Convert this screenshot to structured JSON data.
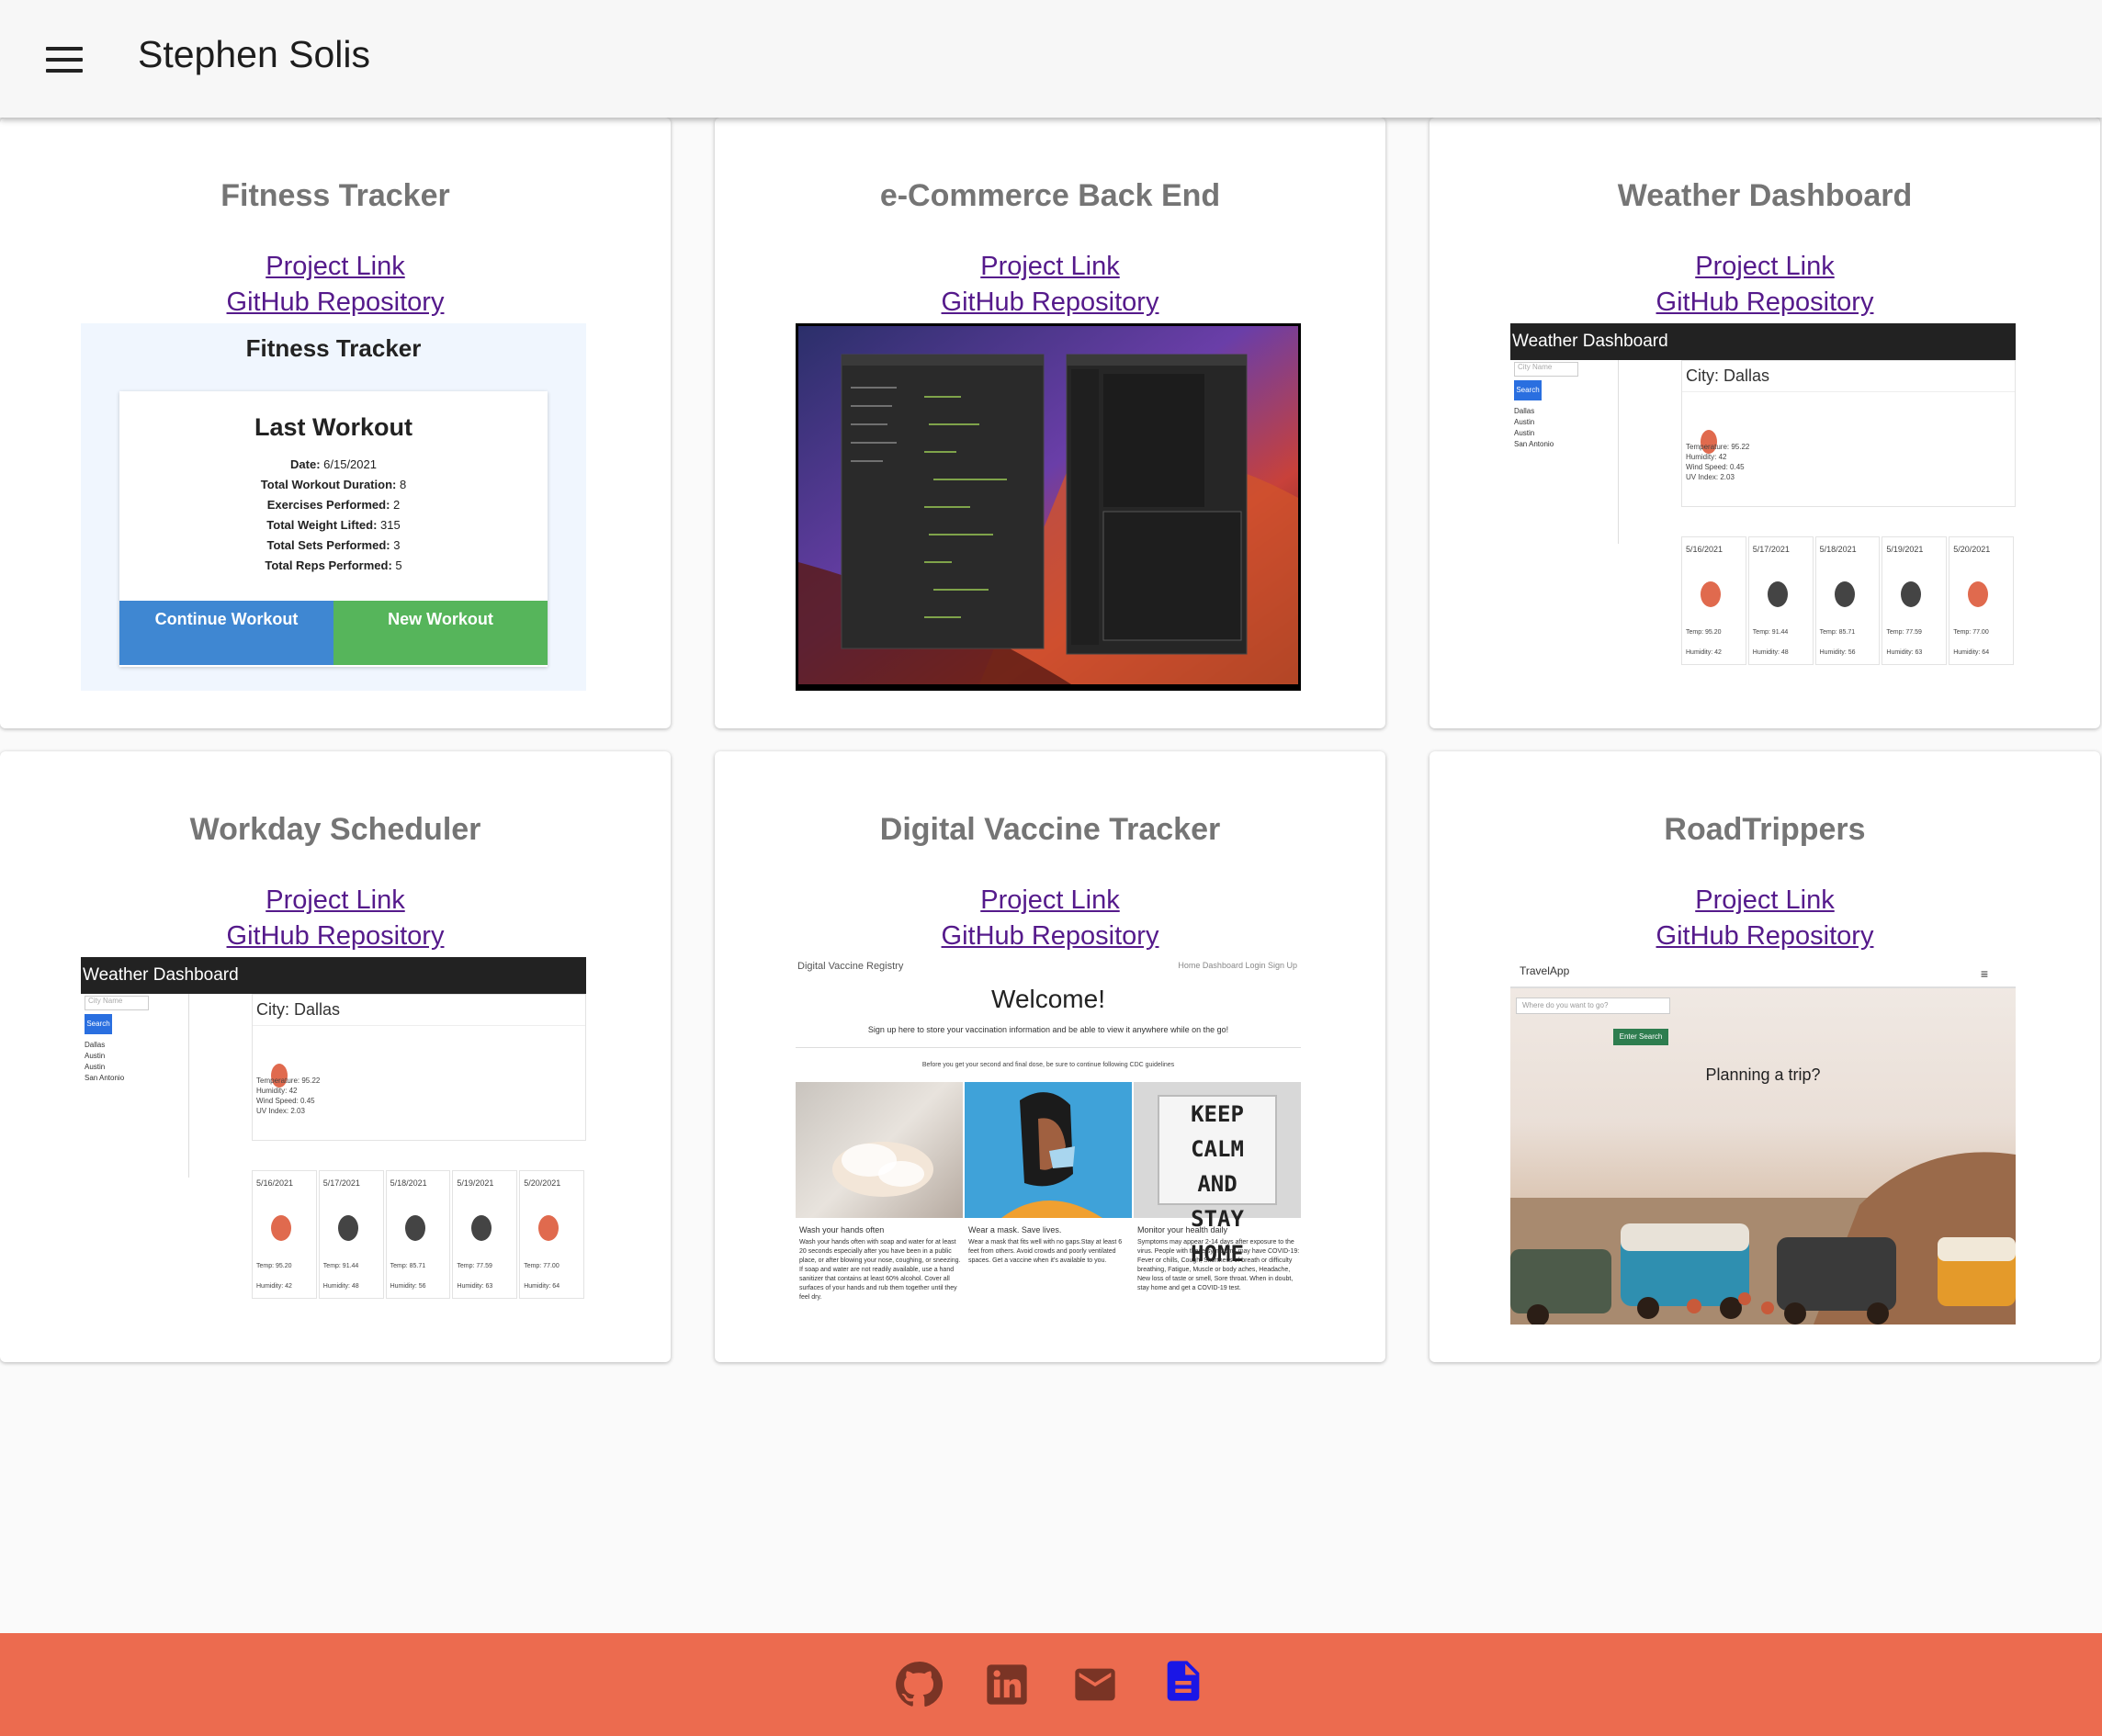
{
  "header": {
    "title": "Stephen Solis"
  },
  "links": {
    "project": "Project Link",
    "github": "GitHub Repository"
  },
  "projects": [
    {
      "title": "Fitness Tracker"
    },
    {
      "title": "e-Commerce Back End"
    },
    {
      "title": "Weather Dashboard"
    },
    {
      "title": "Workday Scheduler"
    },
    {
      "title": "Digital Vaccine Tracker"
    },
    {
      "title": "RoadTrippers"
    }
  ],
  "fitness_shot": {
    "heading": "Fitness Tracker",
    "card_title": "Last Workout",
    "stats": [
      {
        "label": "Date",
        "value": "6/15/2021"
      },
      {
        "label": "Total Workout Duration",
        "value": "8"
      },
      {
        "label": "Exercises Performed",
        "value": "2"
      },
      {
        "label": "Total Weight Lifted",
        "value": "315"
      },
      {
        "label": "Total Sets Performed",
        "value": "3"
      },
      {
        "label": "Total Reps Performed",
        "value": "5"
      }
    ],
    "continue": "Continue Workout",
    "new": "New Workout"
  },
  "weather_shot": {
    "bar": "Weather Dashboard",
    "placeholder": "City Name",
    "search": "Search",
    "cities": [
      "Dallas",
      "Austin",
      "Austin",
      "San Antonio"
    ],
    "city": "City: Dallas",
    "stats": [
      "Temperature: 95.22",
      "Humidity: 42",
      "Wind Speed: 0.45",
      "UV Index: 2.03"
    ],
    "days": [
      {
        "date": "5/16/2021",
        "temp": "Temp: 95.20",
        "hum": "Humidity: 42"
      },
      {
        "date": "5/17/2021",
        "temp": "Temp: 91.44",
        "hum": "Humidity: 48"
      },
      {
        "date": "5/18/2021",
        "temp": "Temp: 85.71",
        "hum": "Humidity: 56"
      },
      {
        "date": "5/19/2021",
        "temp": "Temp: 77.59",
        "hum": "Humidity: 63"
      },
      {
        "date": "5/20/2021",
        "temp": "Temp: 77.00",
        "hum": "Humidity: 64"
      }
    ]
  },
  "vaccine_shot": {
    "brand": "Digital Vaccine Registry",
    "nav": "Home  Dashboard  Login  Sign Up",
    "welcome": "Welcome!",
    "sub": "Sign up here to store your vaccination information and be able to view it anywhere while on the go!",
    "sub2": "Before you get your second and final dose, be sure to continue following CDC guidelines",
    "sign": [
      "KEEP CALM",
      "AND",
      "STAY HOME"
    ],
    "cols": [
      {
        "title": "Wash your hands often",
        "text": "Wash your hands often with soap and water for at least 20 seconds especially after you have been in a public place, or after blowing your nose, coughing, or sneezing. If soap and water are not readily available, use a hand sanitizer that contains at least 60% alcohol. Cover all surfaces of your hands and rub them together until they feel dry."
      },
      {
        "title": "Wear a mask. Save lives.",
        "text": "Wear a mask that fits well with no gaps.Stay at least 6 feet from others. Avoid crowds and poorly ventilated spaces. Get a vaccine when it's available to you."
      },
      {
        "title": "Monitor your health daily",
        "text": "Symptoms may appear 2-14 days after exposure to the virus. People with these symptoms may have COVID-19: Fever or chills, Cough, Shortness of breath or difficulty breathing, Fatigue, Muscle or body aches, Headache, New loss of taste or smell, Sore throat. When in doubt, stay home and get a COVID-19 test."
      }
    ]
  },
  "road_shot": {
    "app": "TravelApp",
    "placeholder": "Where do you want to go?",
    "button": "Enter Search",
    "tagline": "Planning a trip?"
  },
  "colors": {
    "footer": "#ec6b4f",
    "link": "#551a8b",
    "title": "#757575",
    "resume_icon": "#1a16e6"
  },
  "footer": {
    "icons": [
      "github-icon",
      "linkedin-icon",
      "email-icon",
      "resume-icon"
    ]
  }
}
